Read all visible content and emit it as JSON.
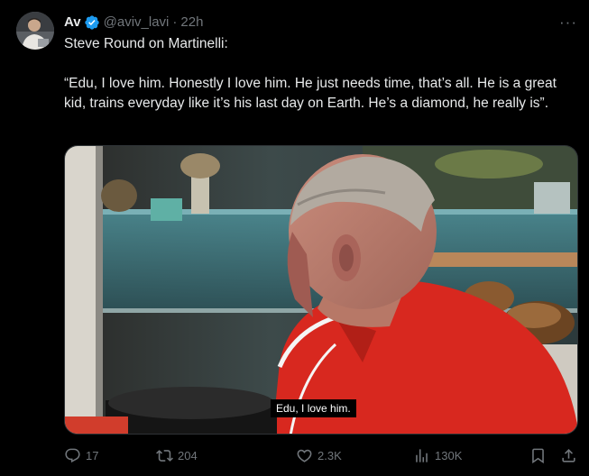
{
  "author": {
    "display_name": "Av",
    "handle": "@aviv_lavi",
    "separator": "·",
    "time": "22h",
    "verified_color": "#1d9bf0"
  },
  "more_label": "···",
  "tweet": {
    "line1": "Steve Round on Martinelli:",
    "line2": "“Edu, I love him. Honestly I love him. He just needs time, that’s all. He is a great kid, trains everyday like it’s his last day on Earth. He’s a diamond, he really is”."
  },
  "media": {
    "caption": "Edu, I love him."
  },
  "actions": {
    "replies": "17",
    "reposts": "204",
    "likes": "2.3K",
    "views": "130K"
  },
  "colors": {
    "background": "#000000",
    "text": "#e7e9ea",
    "muted": "#71767b",
    "border": "#2f3336",
    "jersey": "#d8281f"
  }
}
